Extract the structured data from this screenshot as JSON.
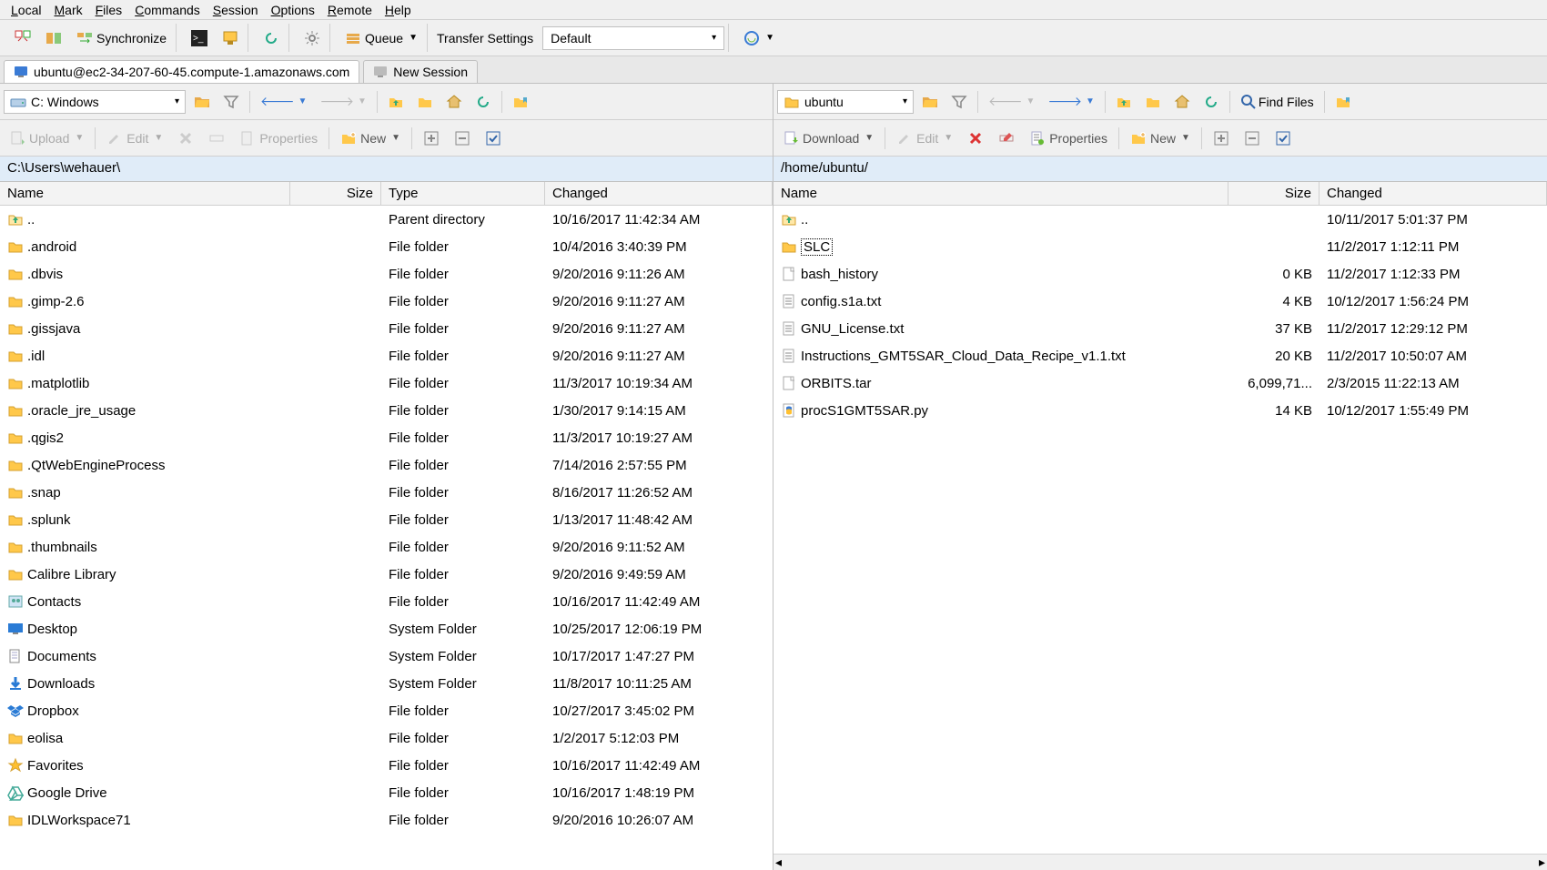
{
  "menu": {
    "local": "Local",
    "mark": "Mark",
    "files": "Files",
    "commands": "Commands",
    "session": "Session",
    "options": "Options",
    "remote": "Remote",
    "help": "Help"
  },
  "toolbar": {
    "sync": "Synchronize",
    "queue": "Queue",
    "transfer_label": "Transfer Settings",
    "transfer_value": "Default"
  },
  "tabs": {
    "session": "ubuntu@ec2-34-207-60-45.compute-1.amazonaws.com",
    "new": "New Session"
  },
  "left": {
    "drive": "C: Windows",
    "upload": "Upload",
    "edit": "Edit",
    "properties": "Properties",
    "new": "New",
    "path": "C:\\Users\\wehauer\\",
    "cols": {
      "name": "Name",
      "size": "Size",
      "type": "Type",
      "changed": "Changed"
    },
    "rows": [
      {
        "icon": "up",
        "name": "..",
        "size": "",
        "type": "Parent directory",
        "changed": "10/16/2017  11:42:34 AM"
      },
      {
        "icon": "folder",
        "name": ".android",
        "size": "",
        "type": "File folder",
        "changed": "10/4/2016  3:40:39 PM"
      },
      {
        "icon": "folder",
        "name": ".dbvis",
        "size": "",
        "type": "File folder",
        "changed": "9/20/2016  9:11:26 AM"
      },
      {
        "icon": "folder",
        "name": ".gimp-2.6",
        "size": "",
        "type": "File folder",
        "changed": "9/20/2016  9:11:27 AM"
      },
      {
        "icon": "folder",
        "name": ".gissjava",
        "size": "",
        "type": "File folder",
        "changed": "9/20/2016  9:11:27 AM"
      },
      {
        "icon": "folder",
        "name": ".idl",
        "size": "",
        "type": "File folder",
        "changed": "9/20/2016  9:11:27 AM"
      },
      {
        "icon": "folder",
        "name": ".matplotlib",
        "size": "",
        "type": "File folder",
        "changed": "11/3/2017  10:19:34 AM"
      },
      {
        "icon": "folder",
        "name": ".oracle_jre_usage",
        "size": "",
        "type": "File folder",
        "changed": "1/30/2017  9:14:15 AM"
      },
      {
        "icon": "folder",
        "name": ".qgis2",
        "size": "",
        "type": "File folder",
        "changed": "11/3/2017  10:19:27 AM"
      },
      {
        "icon": "folder",
        "name": ".QtWebEngineProcess",
        "size": "",
        "type": "File folder",
        "changed": "7/14/2016  2:57:55 PM"
      },
      {
        "icon": "folder",
        "name": ".snap",
        "size": "",
        "type": "File folder",
        "changed": "8/16/2017  11:26:52 AM"
      },
      {
        "icon": "folder",
        "name": ".splunk",
        "size": "",
        "type": "File folder",
        "changed": "1/13/2017  11:48:42 AM"
      },
      {
        "icon": "folder",
        "name": ".thumbnails",
        "size": "",
        "type": "File folder",
        "changed": "9/20/2016  9:11:52 AM"
      },
      {
        "icon": "folder",
        "name": "Calibre Library",
        "size": "",
        "type": "File folder",
        "changed": "9/20/2016  9:49:59 AM"
      },
      {
        "icon": "contacts",
        "name": "Contacts",
        "size": "",
        "type": "File folder",
        "changed": "10/16/2017  11:42:49 AM"
      },
      {
        "icon": "desktop",
        "name": "Desktop",
        "size": "",
        "type": "System Folder",
        "changed": "10/25/2017  12:06:19 PM"
      },
      {
        "icon": "documents",
        "name": "Documents",
        "size": "",
        "type": "System Folder",
        "changed": "10/17/2017  1:47:27 PM"
      },
      {
        "icon": "downloads",
        "name": "Downloads",
        "size": "",
        "type": "System Folder",
        "changed": "11/8/2017  10:11:25 AM"
      },
      {
        "icon": "dropbox",
        "name": "Dropbox",
        "size": "",
        "type": "File folder",
        "changed": "10/27/2017  3:45:02 PM"
      },
      {
        "icon": "folder",
        "name": "eolisa",
        "size": "",
        "type": "File folder",
        "changed": "1/2/2017  5:12:03 PM"
      },
      {
        "icon": "star",
        "name": "Favorites",
        "size": "",
        "type": "File folder",
        "changed": "10/16/2017  11:42:49 AM"
      },
      {
        "icon": "gdrive",
        "name": "Google Drive",
        "size": "",
        "type": "File folder",
        "changed": "10/16/2017  1:48:19 PM"
      },
      {
        "icon": "folder",
        "name": "IDLWorkspace71",
        "size": "",
        "type": "File folder",
        "changed": "9/20/2016  10:26:07 AM"
      }
    ]
  },
  "right": {
    "drive": "ubuntu",
    "download": "Download",
    "edit": "Edit",
    "properties": "Properties",
    "new": "New",
    "find": "Find Files",
    "path": "/home/ubuntu/",
    "cols": {
      "name": "Name",
      "size": "Size",
      "changed": "Changed"
    },
    "rows": [
      {
        "icon": "up",
        "name": "..",
        "size": "",
        "changed": "10/11/2017 5:01:37 PM",
        "sel": false
      },
      {
        "icon": "folder",
        "name": "SLC",
        "size": "",
        "changed": "11/2/2017 1:12:11 PM",
        "sel": true
      },
      {
        "icon": "file",
        "name": "bash_history",
        "size": "0 KB",
        "changed": "11/2/2017 1:12:33 PM",
        "sel": false
      },
      {
        "icon": "text",
        "name": "config.s1a.txt",
        "size": "4 KB",
        "changed": "10/12/2017 1:56:24 PM",
        "sel": false
      },
      {
        "icon": "text",
        "name": "GNU_License.txt",
        "size": "37 KB",
        "changed": "11/2/2017 12:29:12 PM",
        "sel": false
      },
      {
        "icon": "text",
        "name": "Instructions_GMT5SAR_Cloud_Data_Recipe_v1.1.txt",
        "size": "20 KB",
        "changed": "11/2/2017 10:50:07 AM",
        "sel": false
      },
      {
        "icon": "file",
        "name": "ORBITS.tar",
        "size": "6,099,71...",
        "changed": "2/3/2015 11:22:13 AM",
        "sel": false
      },
      {
        "icon": "python",
        "name": "procS1GMT5SAR.py",
        "size": "14 KB",
        "changed": "10/12/2017 1:55:49 PM",
        "sel": false
      }
    ]
  }
}
